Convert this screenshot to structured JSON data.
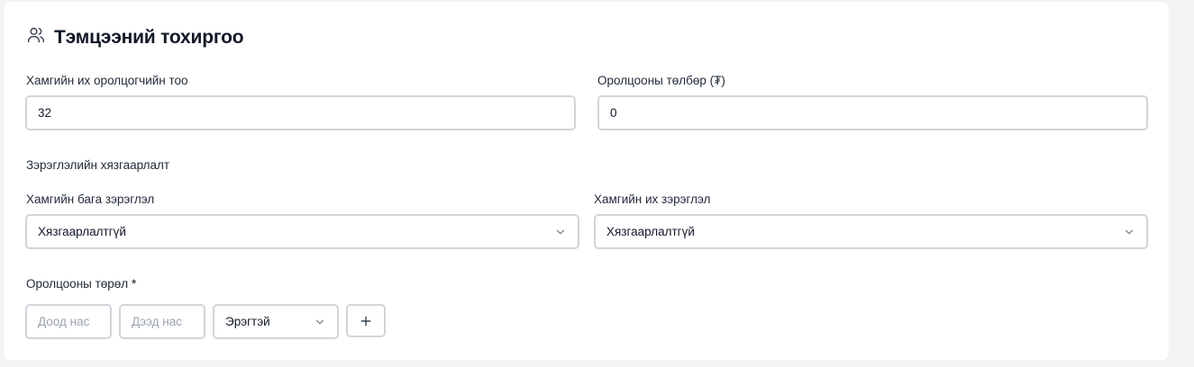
{
  "section": {
    "title": "Тэмцээний тохиргоо",
    "icon": "users-icon"
  },
  "max_participants": {
    "label": "Хамгийн их оролцогчийн тоо",
    "value": "32"
  },
  "entry_fee": {
    "label": "Оролцооны төлбөр (₮)",
    "value": "0"
  },
  "rank_limit": {
    "heading": "Зэрэглэлийн хязгаарлалт",
    "min": {
      "label": "Хамгийн бага зэрэглэл",
      "selected": "Хязгаарлалтгүй"
    },
    "max": {
      "label": "Хамгийн их зэрэглэл",
      "selected": "Хязгаарлалтгүй"
    }
  },
  "participation_type": {
    "label": "Оролцооны төрөл",
    "required_mark": "*",
    "min_age_placeholder": "Доод нас",
    "max_age_placeholder": "Дээд нас",
    "gender_selected": "Эрэгтэй",
    "add_icon": "plus-icon"
  }
}
